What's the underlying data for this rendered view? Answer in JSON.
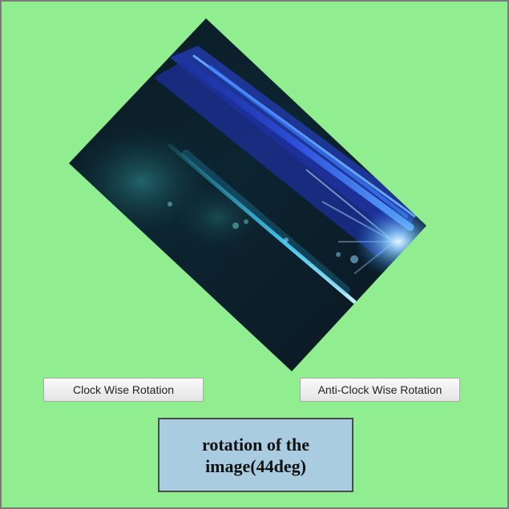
{
  "app": {
    "background_color": "#90ee90"
  },
  "image": {
    "description_icon": "abstract-blue-light-streak-image",
    "rotation_deg": 44
  },
  "buttons": {
    "clockwise_label": "Clock Wise Rotation",
    "anticlockwise_label": "Anti-Clock Wise Rotation"
  },
  "status": {
    "text": "rotation of the image(44deg)",
    "background_color": "#a9cce0"
  }
}
